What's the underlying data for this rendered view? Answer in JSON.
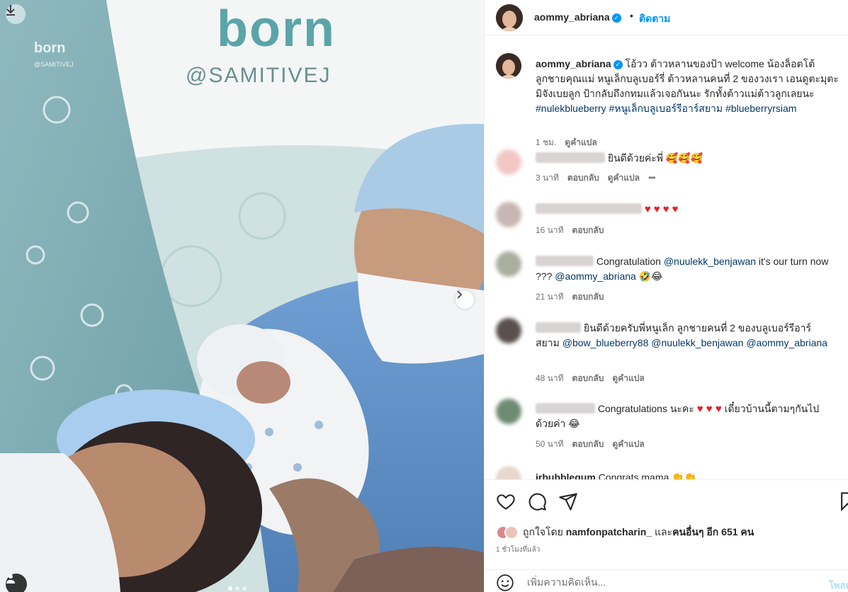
{
  "photo": {
    "banner_brand": "born",
    "banner_sub": "@SAMITIVEJ",
    "pattern_brand": "born",
    "pattern_sub": "@SAMITIVEJ"
  },
  "header": {
    "username": "aommy_abriana",
    "dot": "•",
    "follow_label": "ติดตาม"
  },
  "caption": {
    "username": "aommy_abriana",
    "text": " โอ้วว ต้าวหลานของป้า welcome น้องล็อตโต้ ลูกชายคุณแม่ หนูเล็กบลูเบอร์รี่ ต้าวหลานคนที่ 2 ของวงเรา เอนดูตะมุตะมิจังเบยลูก ป้ากลับถึงกทมแล้วเจอกันนะ รักทั้งต้าวแม่ต้าวลูกเลยนะ ",
    "hashtags": "#nulekblueberry #หนูเล็กบลูเบอร์รีอาร์สยาม #blueberryrsiam",
    "time": "1 ชม.",
    "translate": "ดูคำแปล"
  },
  "comments": [
    {
      "text": "ยินดีด้วยค่ะพี่ 🥰🥰🥰",
      "time": "3 นาที",
      "reply": "ตอบกลับ",
      "translate": "ดูคำแปล",
      "more": "•••"
    },
    {
      "text": "♥♥♥♥",
      "time": "16 นาที",
      "reply": "ตอบกลับ"
    },
    {
      "text1": "Congratulation ",
      "mention1": "@nuulekk_benjawan",
      "text2": " it's our turn now ??? ",
      "mention2": "@aommy_abriana",
      "text3": " 🤣😂",
      "time": "21 นาที",
      "reply": "ตอบกลับ"
    },
    {
      "text1": "ยินดีด้วยครับพี่หนูเล็ก ลูกชายคนที่ 2 ของบลูเบอร์รีอาร์สยาม ",
      "mention1": "@bow_blueberry88",
      "mention2": "@nuulekk_benjawan",
      "mention3": "@aommy_abriana",
      "time": "48 นาที",
      "reply": "ตอบกลับ",
      "translate": "ดูคำแปล"
    },
    {
      "text1": "Congratulations นะคะ ",
      "hearts": "♥ ♥ ♥",
      "text2": " เดี๋ยวบ้านนี้ตามๆกันไปด้วยค่า 😂",
      "time": "50 นาที",
      "reply": "ตอบกลับ",
      "translate": "ดูคำแปล"
    },
    {
      "username": "irbubblegum",
      "text": "Congrats mama 👏👏"
    }
  ],
  "likes": {
    "prefix": "ถูกใจโดย ",
    "user": "namfonpatcharin_",
    "middle": " และ",
    "others": "คนอื่นๆ อีก 651 คน"
  },
  "time_ago": "1 ชั่วโมงที่แล้ว",
  "add_comment": {
    "placeholder": "เพิ่มความคิดเห็น...",
    "post_label": "โพสต์"
  }
}
